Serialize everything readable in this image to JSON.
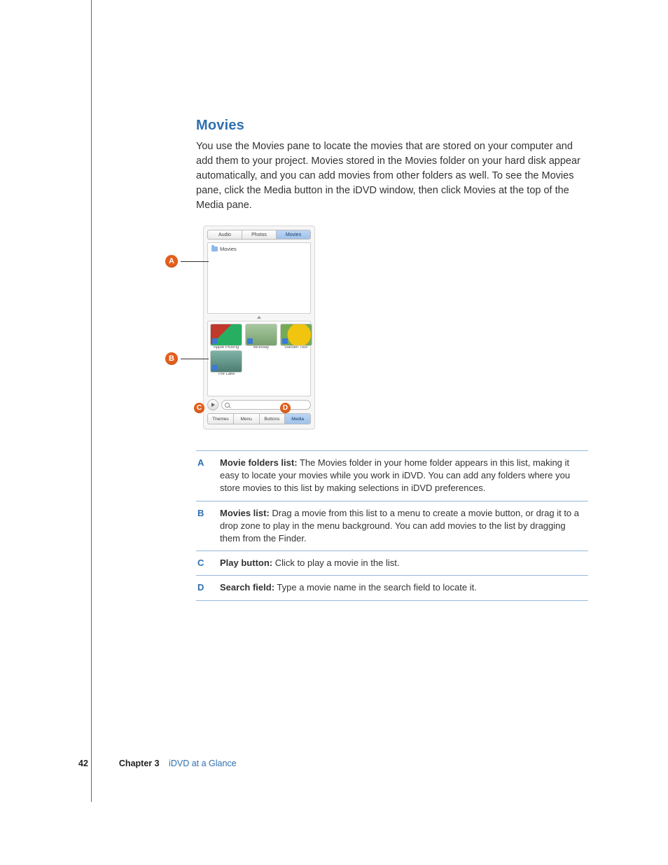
{
  "section_heading": "Movies",
  "lead_paragraph": "You use the Movies pane to locate the movies that are stored on your computer and add them to your project. Movies stored in the Movies folder on your hard disk appear automatically, and you can add movies from other folders as well. To see the Movies pane, click the Media button in the iDVD window, then click Movies at the top of the Media pane.",
  "screenshot": {
    "top_tabs": {
      "audio": "Audio",
      "photos": "Photos",
      "movies": "Movies"
    },
    "folder_label": "Movies",
    "thumbs": {
      "apple": "Apple Picking",
      "birthday": "Birthday",
      "garden": "Garden Tour",
      "lake": "The Lake"
    },
    "bottom_tabs": {
      "themes": "Themes",
      "menu": "Menu",
      "buttons": "Buttons",
      "media": "Media"
    }
  },
  "callouts": {
    "a": "A",
    "b": "B",
    "c": "C",
    "d": "D"
  },
  "legend": {
    "a": {
      "key": "A",
      "term": "Movie folders list:",
      "desc": "  The Movies folder in your home folder appears in this list, making it easy to locate your movies while you work in iDVD. You can add any folders where you store movies to this list by making selections in iDVD preferences."
    },
    "b": {
      "key": "B",
      "term": "Movies list:",
      "desc": "  Drag a movie from this list to a menu to create a movie button, or drag it to a drop zone to play in the menu background. You can add movies to the list by dragging them from the Finder."
    },
    "c": {
      "key": "C",
      "term": "Play button:",
      "desc": "  Click to play a movie in the list."
    },
    "d": {
      "key": "D",
      "term": "Search field:",
      "desc": "  Type a movie name in the search field to locate it."
    }
  },
  "footer": {
    "page": "42",
    "chapter_label": "Chapter 3",
    "chapter_title": "iDVD at a Glance"
  }
}
